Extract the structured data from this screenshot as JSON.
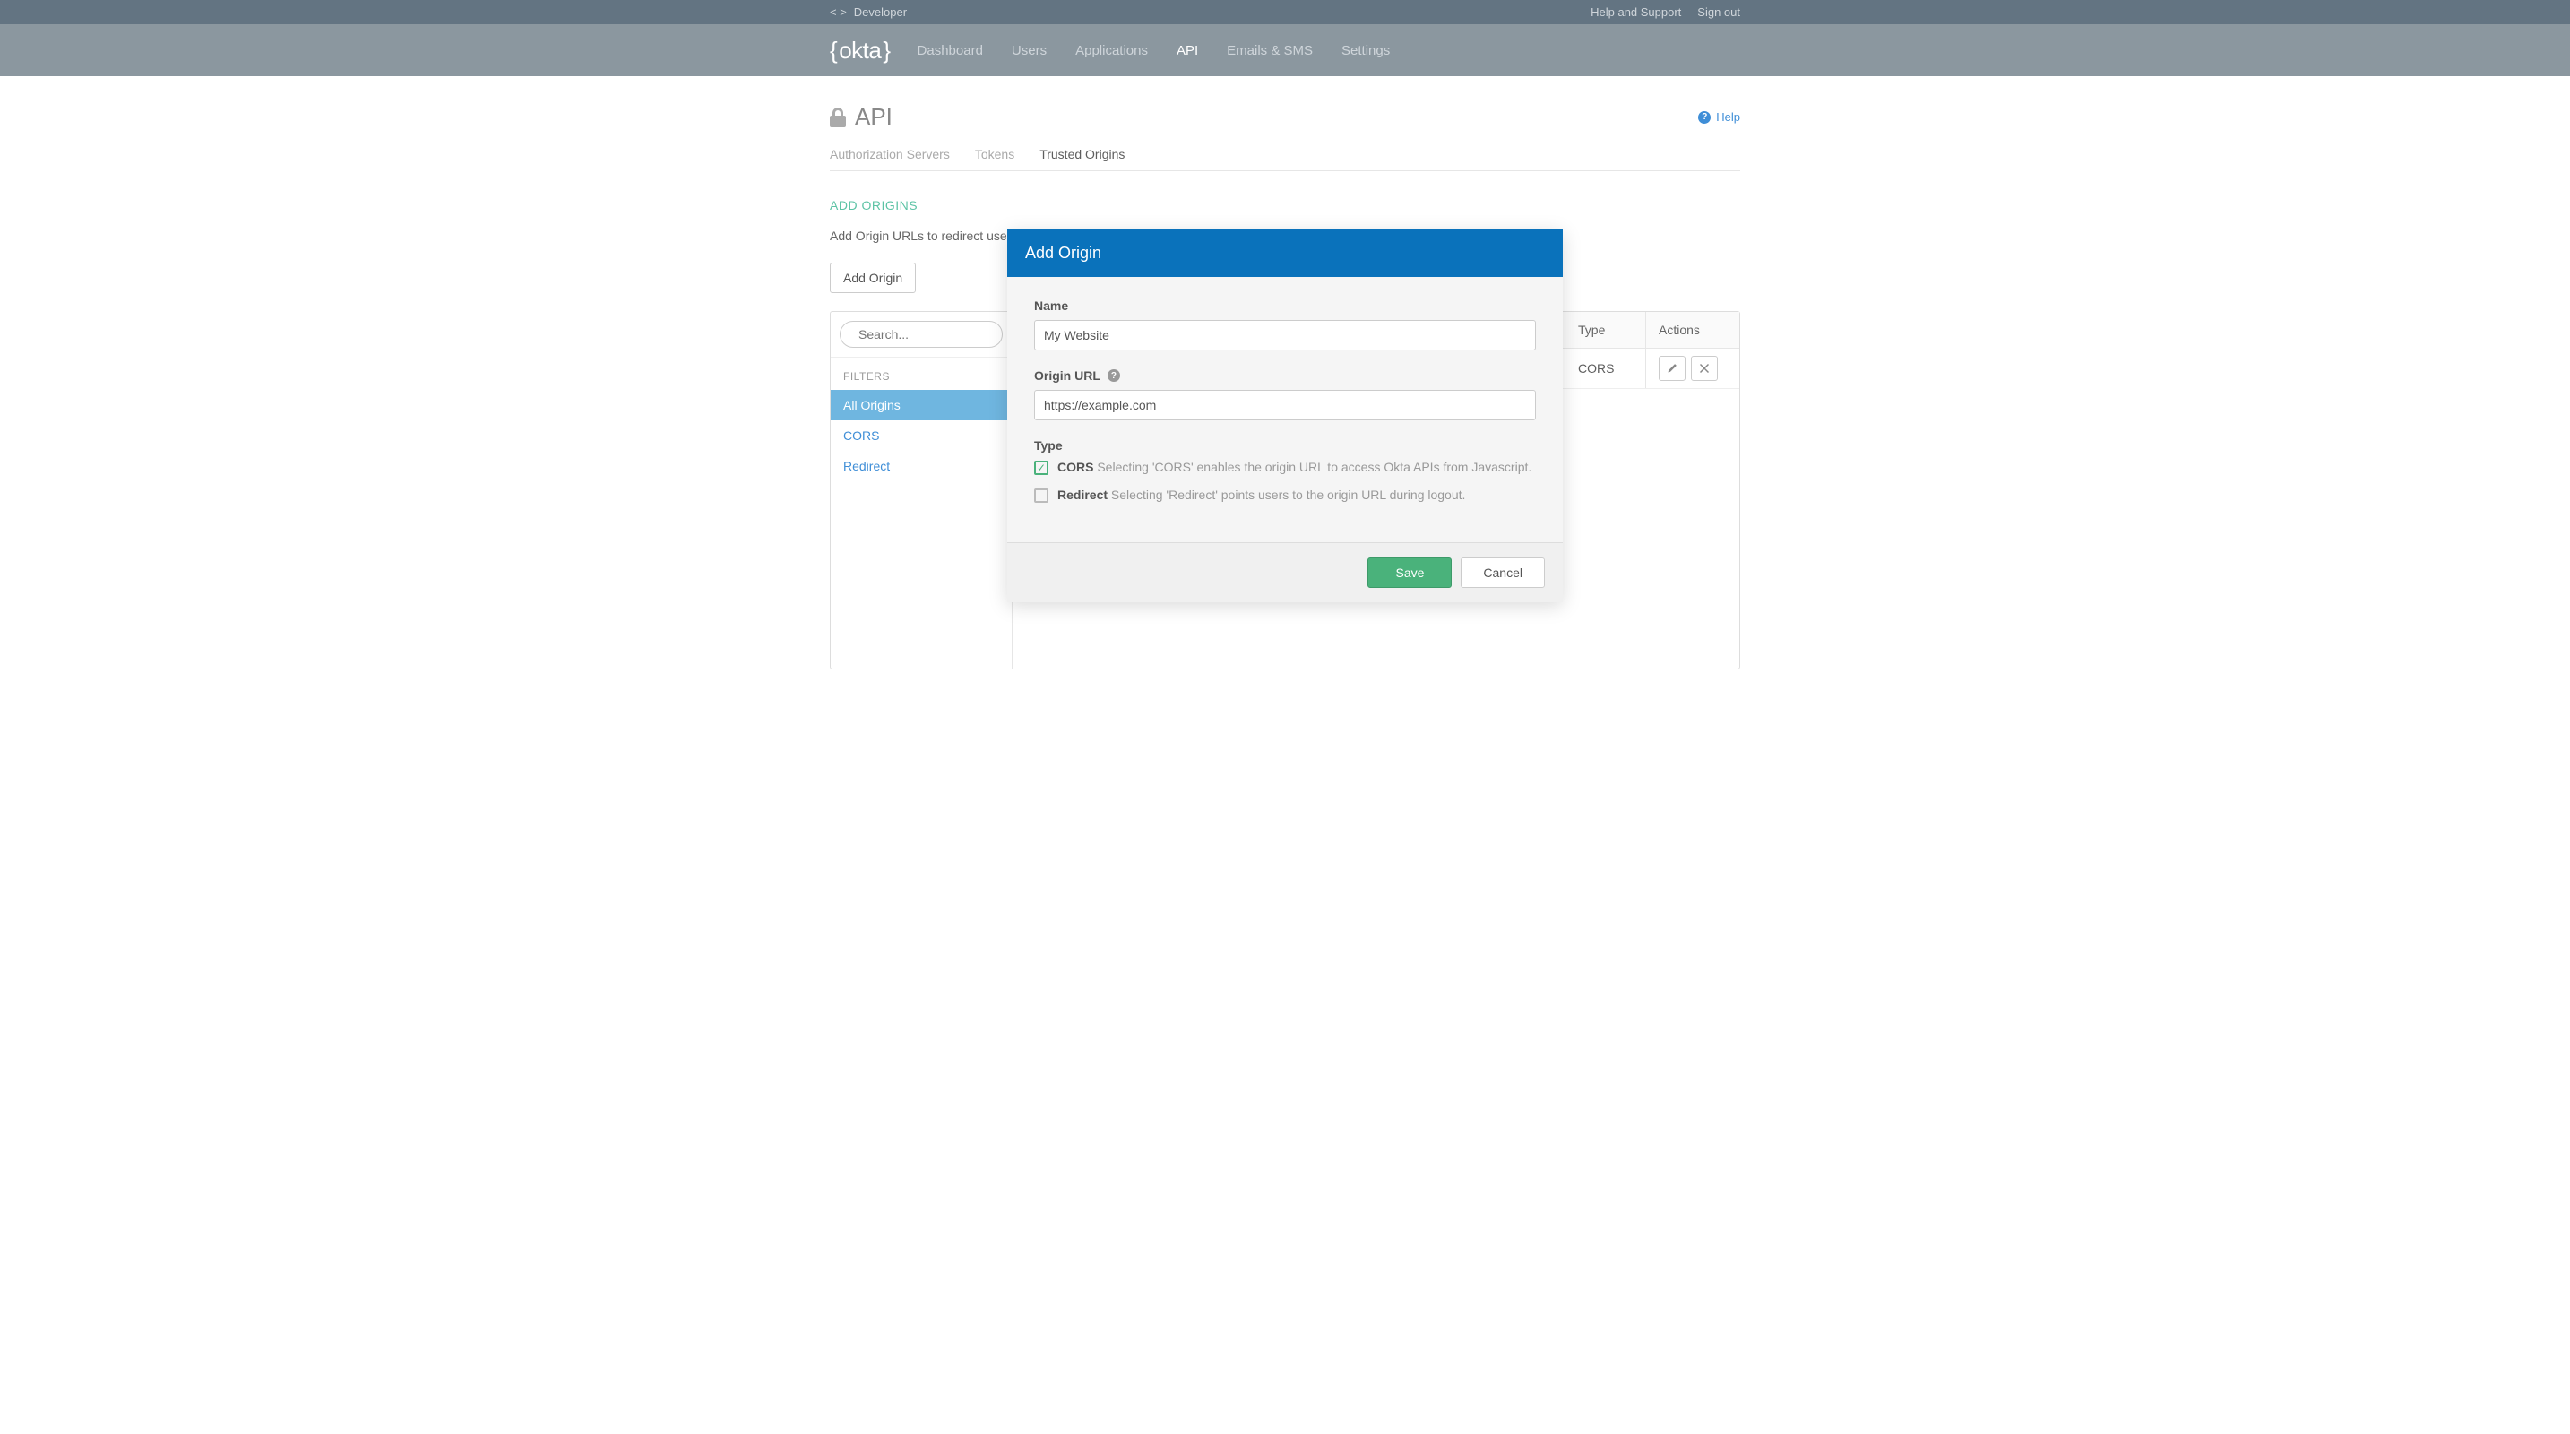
{
  "topbar": {
    "dev_label": "Developer",
    "help": "Help and Support",
    "signout": "Sign out"
  },
  "logo": "okta",
  "nav": {
    "dashboard": "Dashboard",
    "users": "Users",
    "applications": "Applications",
    "api": "API",
    "emails": "Emails & SMS",
    "settings": "Settings"
  },
  "page": {
    "title": "API",
    "help": "Help"
  },
  "subtabs": {
    "auth": "Authorization Servers",
    "tokens": "Tokens",
    "trusted": "Trusted Origins"
  },
  "section": {
    "title": "ADD ORIGINS",
    "desc": "Add Origin URLs to redirect users",
    "add_btn": "Add Origin"
  },
  "panel": {
    "search_placeholder": "Search...",
    "filters_label": "FILTERS",
    "filter_all": "All Origins",
    "filter_cors": "CORS",
    "filter_redirect": "Redirect",
    "col_type": "Type",
    "col_actions": "Actions",
    "row_type": "CORS"
  },
  "modal": {
    "title": "Add Origin",
    "name_label": "Name",
    "name_value": "My Website",
    "url_label": "Origin URL",
    "url_value": "https://example.com",
    "type_label": "Type",
    "cors_label": "CORS",
    "cors_desc": "Selecting 'CORS' enables the origin URL to access Okta APIs from Javascript.",
    "redirect_label": "Redirect",
    "redirect_desc": "Selecting 'Redirect' points users to the origin URL during logout.",
    "save": "Save",
    "cancel": "Cancel"
  }
}
